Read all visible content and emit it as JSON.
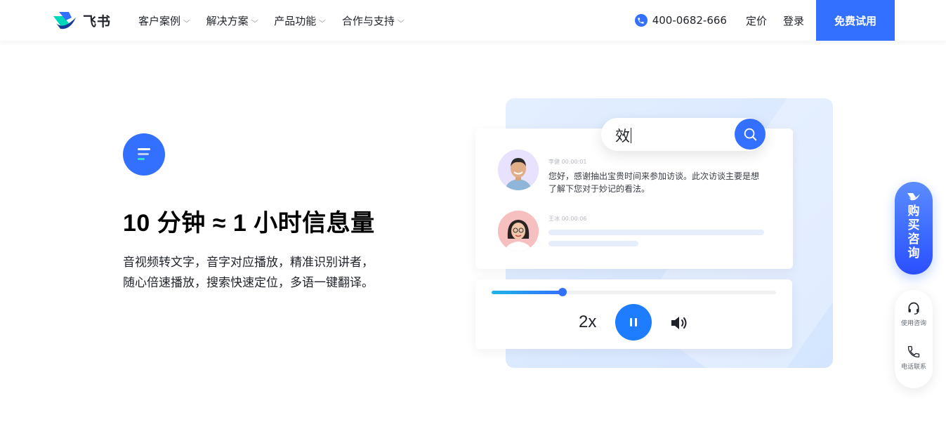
{
  "header": {
    "logo_text": "飞书",
    "nav": [
      {
        "label": "客户案例"
      },
      {
        "label": "解决方案"
      },
      {
        "label": "产品功能"
      },
      {
        "label": "合作与支持"
      }
    ],
    "phone": "400-0682-666",
    "pricing": "定价",
    "login": "登录",
    "cta": "免费试用"
  },
  "feature": {
    "icon": "transcript-lines-icon",
    "title": "10 分钟 ≈ 1 小时信息量",
    "desc_line1": "音视频转文字，音字对应播放，精准识别讲者，",
    "desc_line2": "随心倍速播放，搜索快速定位，多语一键翻译。"
  },
  "illustration": {
    "search_text": "效",
    "speaker1_meta": "李健  00:00:01",
    "speaker1_text": "您好，感谢抽出宝贵时间来参加访谈。此次访谈主要是想了解下您对于妙记的看法。",
    "speaker2_meta": "王冰  00:00:06",
    "playback_progress": 0.25,
    "speed": "2x"
  },
  "sidebar": {
    "buy_label": "购买咨询",
    "tool1_label": "使用咨询",
    "tool2_label": "电话联系"
  },
  "colors": {
    "brand": "#3370ff",
    "text": "#1f2329"
  }
}
